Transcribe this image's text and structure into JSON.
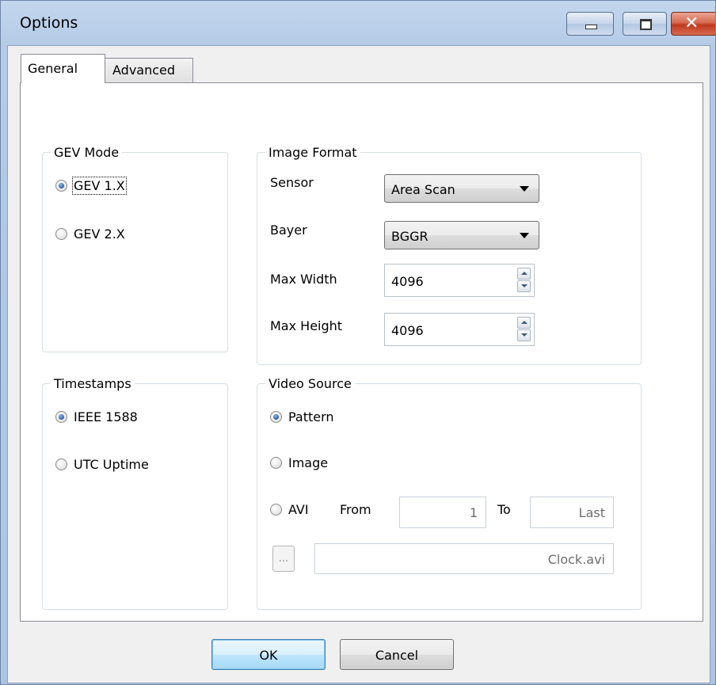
{
  "window": {
    "title": "Options"
  },
  "tabs": [
    {
      "label": "General",
      "active": true
    },
    {
      "label": "Advanced",
      "active": false
    }
  ],
  "gev_mode": {
    "legend": "GEV Mode",
    "options": [
      {
        "label": "GEV 1.X",
        "checked": true
      },
      {
        "label": "GEV 2.X",
        "checked": false
      }
    ]
  },
  "image_format": {
    "legend": "Image Format",
    "sensor_label": "Sensor",
    "sensor_value": "Area Scan",
    "bayer_label": "Bayer",
    "bayer_value": "BGGR",
    "max_width_label": "Max Width",
    "max_width_value": "4096",
    "max_height_label": "Max Height",
    "max_height_value": "4096"
  },
  "timestamps": {
    "legend": "Timestamps",
    "options": [
      {
        "label": "IEEE 1588",
        "checked": true
      },
      {
        "label": "UTC Uptime",
        "checked": false
      }
    ]
  },
  "video_source": {
    "legend": "Video Source",
    "pattern_label": "Pattern",
    "image_label": "Image",
    "avi_label": "AVI",
    "from_label": "From",
    "from_value": "1",
    "to_label": "To",
    "to_value": "Last",
    "browse_label": "...",
    "file_value": "Clock.avi"
  },
  "buttons": {
    "ok_label": "OK",
    "cancel_label": "Cancel"
  },
  "colors": {
    "title_bar": "#b4cae6",
    "close_button": "#c0391e",
    "radio_checked": "#2a5c9a"
  }
}
